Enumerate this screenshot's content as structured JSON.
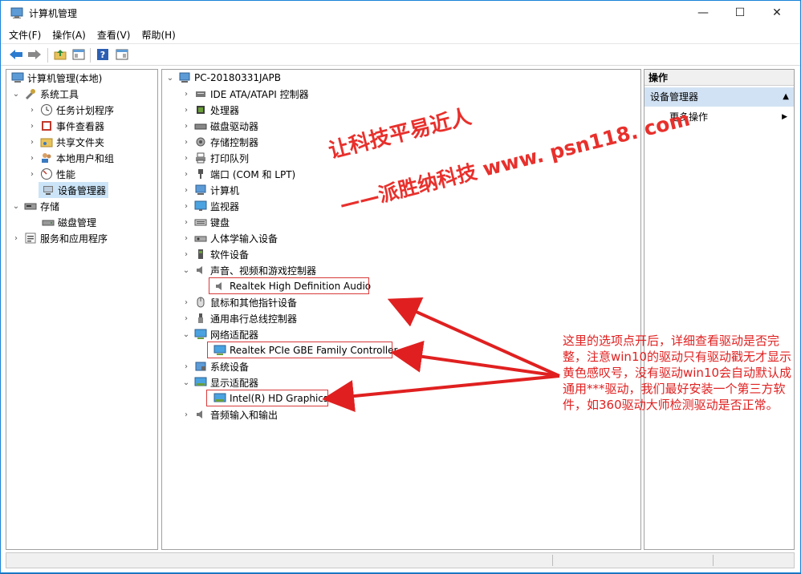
{
  "window": {
    "title": "计算机管理"
  },
  "menu": [
    "文件(F)",
    "操作(A)",
    "查看(V)",
    "帮助(H)"
  ],
  "left_tree": [
    {
      "label": "计算机管理(本地)",
      "icon": "computer-mgmt-icon"
    },
    {
      "label": "系统工具",
      "icon": "tools-icon"
    },
    {
      "label": "任务计划程序",
      "icon": "clock-icon"
    },
    {
      "label": "事件查看器",
      "icon": "event-viewer-icon"
    },
    {
      "label": "共享文件夹",
      "icon": "shared-folder-icon"
    },
    {
      "label": "本地用户和组",
      "icon": "users-icon"
    },
    {
      "label": "性能",
      "icon": "performance-icon"
    },
    {
      "label": "设备管理器",
      "icon": "device-manager-icon"
    },
    {
      "label": "存储",
      "icon": "storage-icon"
    },
    {
      "label": "磁盘管理",
      "icon": "disk-icon"
    },
    {
      "label": "服务和应用程序",
      "icon": "services-icon"
    }
  ],
  "device_tree": {
    "root": "PC-20180331JAPB",
    "items": [
      "IDE ATA/ATAPI 控制器",
      "处理器",
      "磁盘驱动器",
      "存储控制器",
      "打印队列",
      "端口 (COM 和 LPT)",
      "计算机",
      "监视器",
      "键盘",
      "人体学输入设备",
      "软件设备",
      "声音、视频和游戏控制器",
      "Realtek High Definition Audio",
      "鼠标和其他指针设备",
      "通用串行总线控制器",
      "网络适配器",
      "Realtek PCIe GBE Family Controller",
      "系统设备",
      "显示适配器",
      "Intel(R) HD Graphics",
      "音频输入和输出"
    ]
  },
  "actions": {
    "header": "操作",
    "section": "设备管理器",
    "more": "更多操作"
  },
  "annotation": {
    "watermark_line1": "让科技平易近人",
    "watermark_line2": "——派胜纳科技 www. psn118. com",
    "note": "这里的选项点开后，详细查看驱动是否完整，注意win10的驱动只有驱动戳无才显示黄色感叹号，没有驱动win10会自动默认成通用***驱动，我们最好安装一个第三方软件，如360驱动大师检测驱动是否正常。"
  },
  "colors": {
    "annotation_red": "#e02020",
    "selection": "#cce4f7",
    "action_band": "#d1e2f4"
  }
}
